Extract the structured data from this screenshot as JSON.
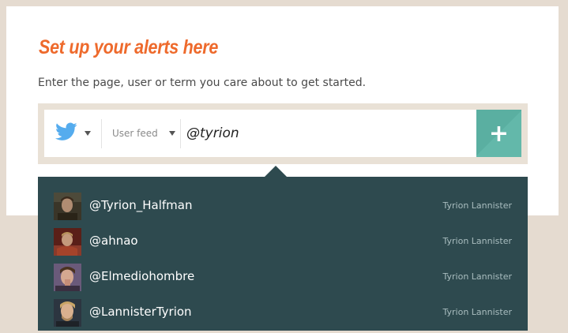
{
  "header": {
    "title": "Set up your alerts here",
    "subtitle": "Enter the page, user or term you care about to get started."
  },
  "search": {
    "source_icon": "twitter-bird-icon",
    "feed_type": "User feed",
    "query": "@tyrion",
    "add_icon": "plus-icon",
    "add_label": "+"
  },
  "colors": {
    "accent_orange": "#ee6a2c",
    "twitter_blue": "#55acee",
    "add_teal": "#5aafa1",
    "dropdown_bg": "#2e4a4f",
    "page_bg": "#e5dbd0"
  },
  "suggestions": [
    {
      "handle": "@Tyrion_Halfman",
      "name": "Tyrion Lannister"
    },
    {
      "handle": "@ahnao",
      "name": "Tyrion Lannister"
    },
    {
      "handle": "@Elmediohombre",
      "name": "Tyrion Lannister"
    },
    {
      "handle": "@LannisterTyrion",
      "name": "Tyrion Lannister"
    }
  ]
}
